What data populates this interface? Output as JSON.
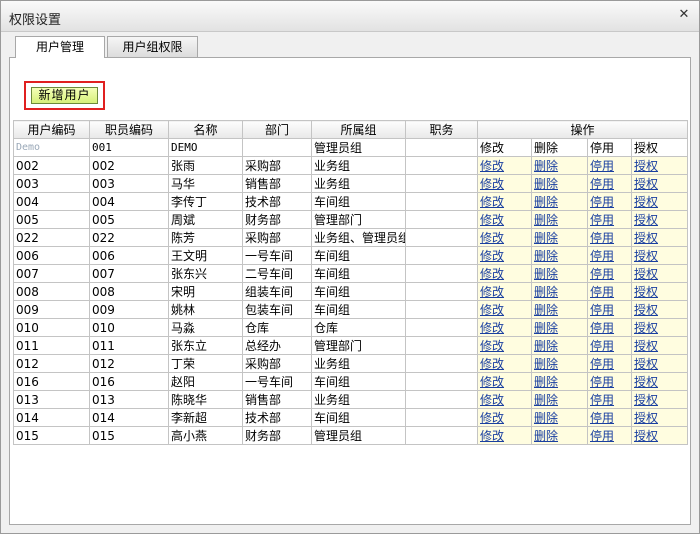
{
  "window": {
    "title": "权限设置",
    "close_glyph": "✕"
  },
  "tabs": [
    {
      "label": "用户管理",
      "active": true
    },
    {
      "label": "用户组权限",
      "active": false
    }
  ],
  "toolbar": {
    "add_user_label": "新增用户"
  },
  "table": {
    "headers": [
      "用户编码",
      "职员编码",
      "名称",
      "部门",
      "所属组",
      "职务",
      "操作"
    ],
    "demo_row": {
      "code": "Demo",
      "staff": "001",
      "name": "DEMO",
      "dept": "",
      "group": "管理员组",
      "title": "",
      "actions": [
        "修改",
        "删除",
        "停用",
        "授权"
      ]
    },
    "action_labels": {
      "edit": "修改",
      "delete": "删除",
      "disable": "停用",
      "grant": "授权"
    },
    "rows": [
      {
        "code": "002",
        "staff": "002",
        "name": "张雨",
        "dept": "采购部",
        "group": "业务组",
        "title": ""
      },
      {
        "code": "003",
        "staff": "003",
        "name": "马华",
        "dept": "销售部",
        "group": "业务组",
        "title": ""
      },
      {
        "code": "004",
        "staff": "004",
        "name": "李传丁",
        "dept": "技术部",
        "group": "车间组",
        "title": ""
      },
      {
        "code": "005",
        "staff": "005",
        "name": "周斌",
        "dept": "财务部",
        "group": "管理部门",
        "title": ""
      },
      {
        "code": "022",
        "staff": "022",
        "name": "陈芳",
        "dept": "采购部",
        "group": "业务组、管理员组",
        "title": ""
      },
      {
        "code": "006",
        "staff": "006",
        "name": "王文明",
        "dept": "一号车间",
        "group": "车间组",
        "title": ""
      },
      {
        "code": "007",
        "staff": "007",
        "name": "张东兴",
        "dept": "二号车间",
        "group": "车间组",
        "title": ""
      },
      {
        "code": "008",
        "staff": "008",
        "name": "宋明",
        "dept": "组装车间",
        "group": "车间组",
        "title": ""
      },
      {
        "code": "009",
        "staff": "009",
        "name": "姚林",
        "dept": "包装车间",
        "group": "车间组",
        "title": ""
      },
      {
        "code": "010",
        "staff": "010",
        "name": "马淼",
        "dept": "仓库",
        "group": "仓库",
        "title": ""
      },
      {
        "code": "011",
        "staff": "011",
        "name": "张东立",
        "dept": "总经办",
        "group": "管理部门",
        "title": ""
      },
      {
        "code": "012",
        "staff": "012",
        "name": "丁荣",
        "dept": "采购部",
        "group": "业务组",
        "title": ""
      },
      {
        "code": "016",
        "staff": "016",
        "name": "赵阳",
        "dept": "一号车间",
        "group": "车间组",
        "title": ""
      },
      {
        "code": "013",
        "staff": "013",
        "name": "陈晓华",
        "dept": "销售部",
        "group": "业务组",
        "title": ""
      },
      {
        "code": "014",
        "staff": "014",
        "name": "李新超",
        "dept": "技术部",
        "group": "车间组",
        "title": ""
      },
      {
        "code": "015",
        "staff": "015",
        "name": "高小燕",
        "dept": "财务部",
        "group": "管理员组",
        "title": ""
      }
    ]
  }
}
